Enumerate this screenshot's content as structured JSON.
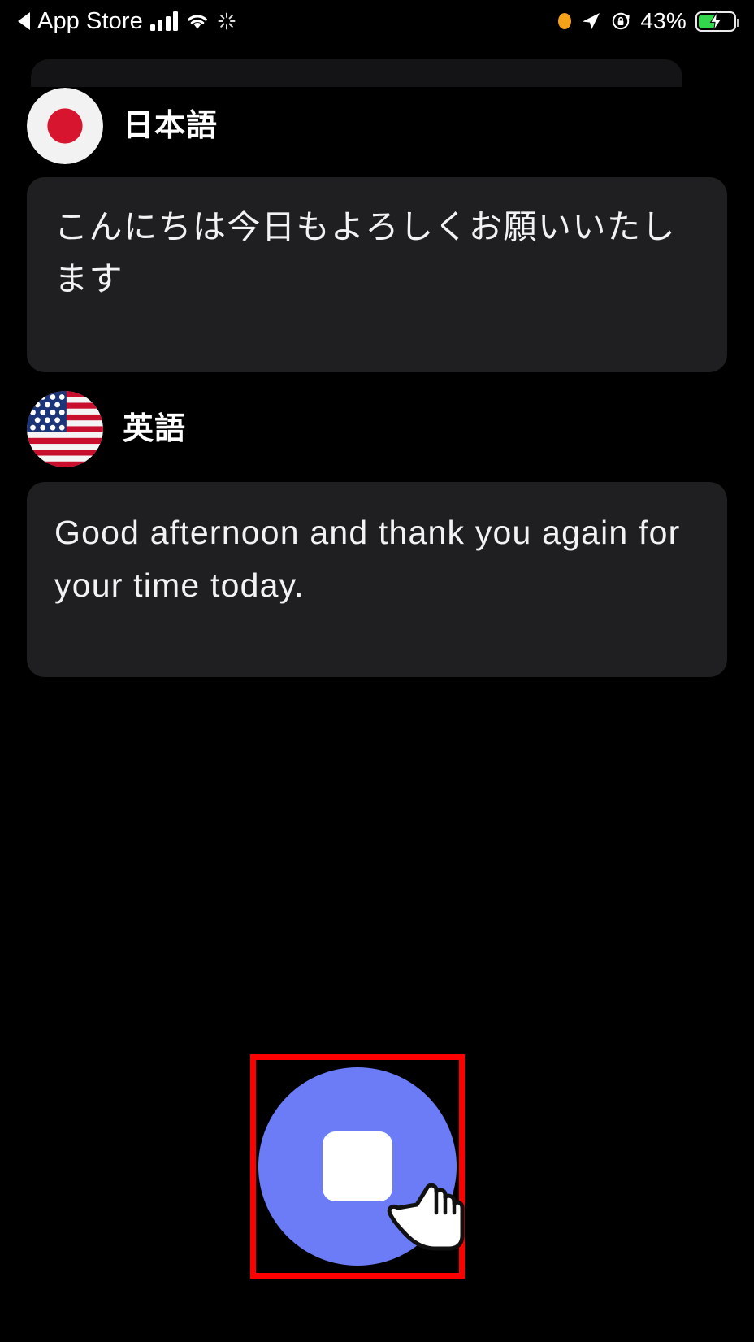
{
  "status_bar": {
    "back_label": "App Store",
    "back_icon": "back-triangle-icon",
    "signal_icon": "cellular-signal-icon",
    "wifi_icon": "wifi-icon",
    "spinner_icon": "activity-spinner-icon",
    "recording_dot_icon": "microphone-in-use-dot-icon",
    "location_icon": "location-arrow-icon",
    "rotation_lock_icon": "rotation-lock-icon",
    "battery_percent": "43%",
    "battery_icon": "battery-charging-icon",
    "battery_level": 43,
    "colors": {
      "recording_dot": "#f5a218",
      "battery_fill": "#32d74b",
      "text": "#ffffff"
    }
  },
  "conversation": {
    "entries": [
      {
        "flag_icon": "flag-japan-icon",
        "language_label": "日本語",
        "text": "こんにちは今日もよろしくお願いいたします"
      },
      {
        "flag_icon": "flag-usa-icon",
        "language_label": "英語",
        "text": "Good afternoon and thank you again for your time today."
      }
    ]
  },
  "record_control": {
    "button_icon": "stop-recording-icon",
    "button_label": "",
    "cursor_icon": "pointing-hand-cursor-icon",
    "highlight_color": "#ff0000",
    "button_color": "#6c7cf7",
    "square_color": "#ffffff"
  },
  "theme": {
    "background": "#000000",
    "card_background": "#1f1f21",
    "text_primary": "#f2f2f4"
  }
}
